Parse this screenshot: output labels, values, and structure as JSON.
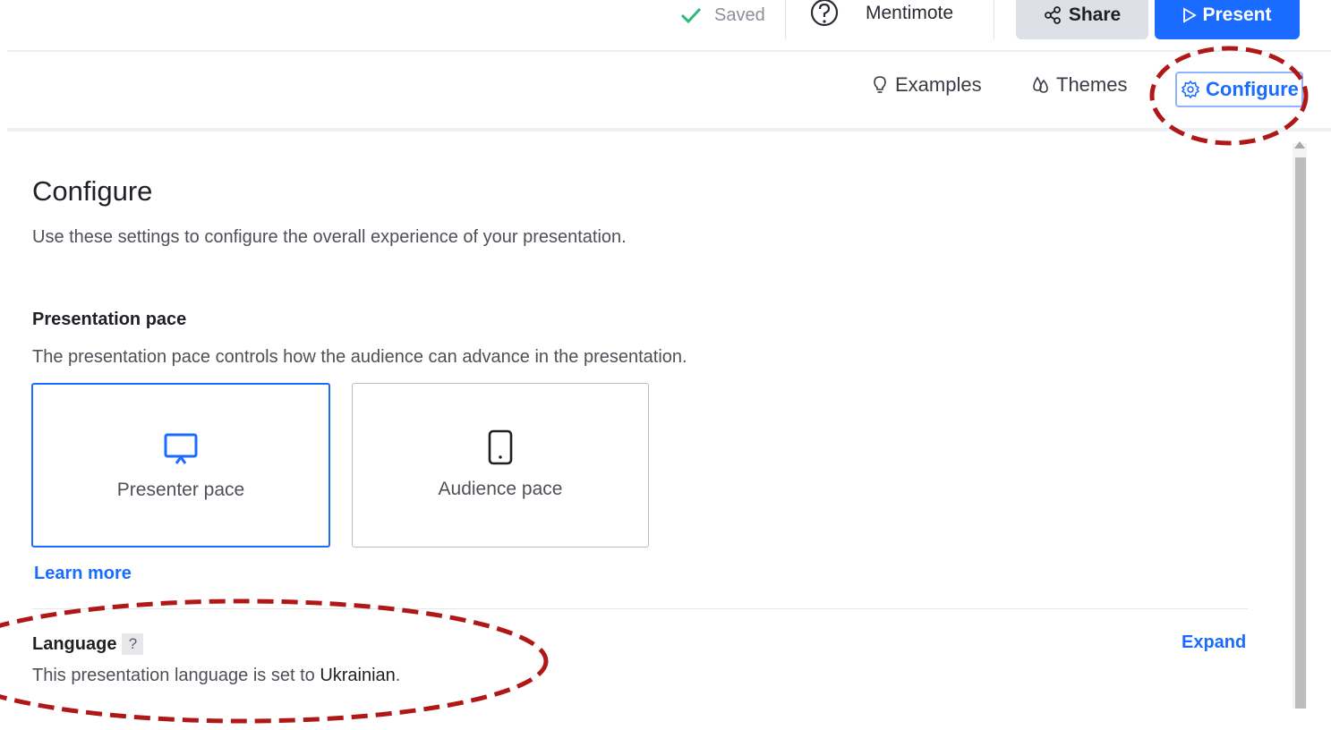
{
  "topbar": {
    "saved_label": "Saved",
    "mentimote_label": "Mentimote",
    "share_label": "Share",
    "present_label": "Present",
    "saved_icon": "check-icon",
    "help_icon": "question-circle-icon",
    "share_icon": "share-icon",
    "present_icon": "play-icon"
  },
  "tabs": [
    {
      "label": "Examples",
      "icon": "lightbulb-icon"
    },
    {
      "label": "Themes",
      "icon": "drops-icon"
    },
    {
      "label": "Configure",
      "icon": "gear-icon",
      "active": true
    }
  ],
  "panel": {
    "title": "Configure",
    "description": "Use these settings to configure the overall experience of your presentation."
  },
  "pace": {
    "title": "Presentation pace",
    "description": "The presentation pace controls how the audience can advance in the presentation.",
    "options": [
      {
        "label": "Presenter pace",
        "icon": "presentation-screen-icon",
        "selected": true
      },
      {
        "label": "Audience pace",
        "icon": "mobile-phone-icon",
        "selected": false
      }
    ],
    "learn_more": "Learn more"
  },
  "language": {
    "title": "Language",
    "help": "?",
    "description_prefix": "This presentation language is set to ",
    "value": "Ukrainian",
    "description_suffix": ".",
    "expand": "Expand"
  },
  "colors": {
    "accent": "#196cff",
    "annotation": "#b01818",
    "share_bg": "#dde0e6"
  }
}
